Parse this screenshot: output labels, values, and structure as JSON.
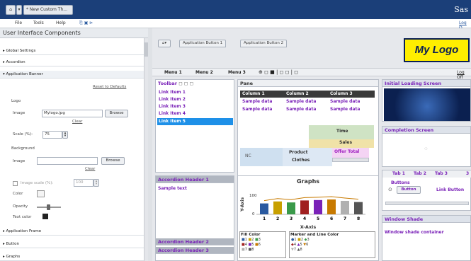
{
  "topbar": {
    "home_icon": "home-icon",
    "tab_title": "* New Custom Th...",
    "brand": "Sas"
  },
  "menu": {
    "file": "File",
    "tools": "Tools",
    "help": "Help",
    "logout": "Log O"
  },
  "left": {
    "title": "User Interface Components",
    "rows": [
      "Global Settings",
      "Accordion",
      "Application Banner"
    ],
    "reset": "Reset to Defaults",
    "logo_section": "Logo",
    "image_label": "Image",
    "image_value": "Mylogo.jpg",
    "browse": "Browse",
    "clear": "Clear",
    "scale_label": "Scale (%):",
    "scale_value": "75",
    "background_section": "Background",
    "bg_image_label": "Image",
    "bg_browse": "Browse",
    "bg_clear": "Clear",
    "image_scale_label": "Image scale (%):",
    "image_scale_value": "100",
    "color_label": "Color",
    "opacity_label": "Opacity",
    "text_color_label": "Text color",
    "bottom_rows": [
      "Application Frame",
      "Button",
      "Graphs"
    ]
  },
  "app": {
    "btn1": "Application Button 1",
    "btn2": "Application Button 2",
    "logo": "My Logo",
    "menu1": "Menu 1",
    "menu2": "Menu 2",
    "menu3": "Menu 3",
    "logoff": "Log Off"
  },
  "toolbar": {
    "title": "Toolbar",
    "links": [
      "Link Item 1",
      "Link Item 2",
      "Link Item 3",
      "Link Item 4",
      "Link Item 5"
    ]
  },
  "pane": {
    "title": "Pane",
    "columns": [
      "Column 1",
      "Column 2",
      "Column 3"
    ],
    "rows": [
      [
        "Sample data",
        "Sample data",
        "Sample data"
      ],
      [
        "Sample data",
        "Sample data",
        "Sample data"
      ]
    ]
  },
  "cross": {
    "time": "Time",
    "sales": "Sales",
    "product": "Product",
    "clothes": "Clothes",
    "offer": "Offer Total",
    "nc": "NC"
  },
  "loading": {
    "title": "Initial Loading Screen"
  },
  "completion": {
    "title": "Completion Screen"
  },
  "tabs": {
    "items": [
      "Tab 1",
      "Tab 2",
      "Tab 3",
      "3"
    ],
    "buttons_label": "Buttons",
    "button": "Button",
    "link_button": "Link Button"
  },
  "window_shade": {
    "title": "Window Shade",
    "text": "Window shade container"
  },
  "accordion": {
    "h1": "Accordion Header 1",
    "text": "Sample text",
    "h2": "Accordion Header 2",
    "h3": "Accordion Header 3"
  },
  "graph": {
    "title": "Graphs",
    "ylabel": "Y-Axis",
    "xlabel": "X-Axis",
    "tick100": "100",
    "tick0": "0",
    "fill_title": "Fill Color",
    "marker_title": "Marker and Line Color"
  },
  "chart_data": {
    "type": "bar",
    "title": "Graphs",
    "xlabel": "X-Axis",
    "ylabel": "Y-Axis",
    "categories": [
      "1",
      "2",
      "3",
      "4",
      "5",
      "6",
      "7",
      "8"
    ],
    "values": [
      55,
      65,
      60,
      70,
      72,
      75,
      68,
      62
    ],
    "ylim": [
      0,
      100
    ]
  }
}
